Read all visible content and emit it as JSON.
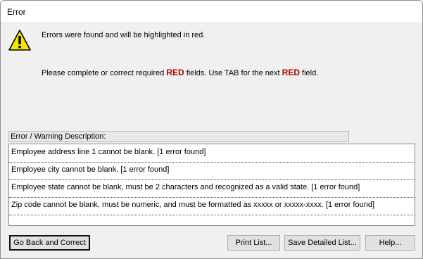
{
  "window": {
    "title": "Error"
  },
  "message": {
    "line1": "Errors were found and will be highlighted in red.",
    "line2_prefix": "Please complete or correct required ",
    "line2_red1": "RED",
    "line2_middle": " fields. Use TAB for the next ",
    "line2_red2": "RED",
    "line2_suffix": " field."
  },
  "list": {
    "header": "Error / Warning Description:",
    "items": [
      "Employee address line 1 cannot be blank.  [1 error found]",
      "Employee city cannot be blank.  [1 error found]",
      "Employee state cannot be blank, must be 2 characters and recognized as a valid state.  [1 error found]",
      "Zip code cannot be blank, must be numeric, and must be formatted as xxxxx or xxxxx-xxxx.  [1 error found]"
    ]
  },
  "buttons": {
    "go_back": "Go Back and Correct",
    "print": "Print List...",
    "save": "Save Detailed List...",
    "help": "Help..."
  },
  "icons": {
    "warning": "warning-triangle-icon"
  },
  "colors": {
    "highlight_red": "#b00000",
    "icon_yellow": "#f5e400"
  }
}
